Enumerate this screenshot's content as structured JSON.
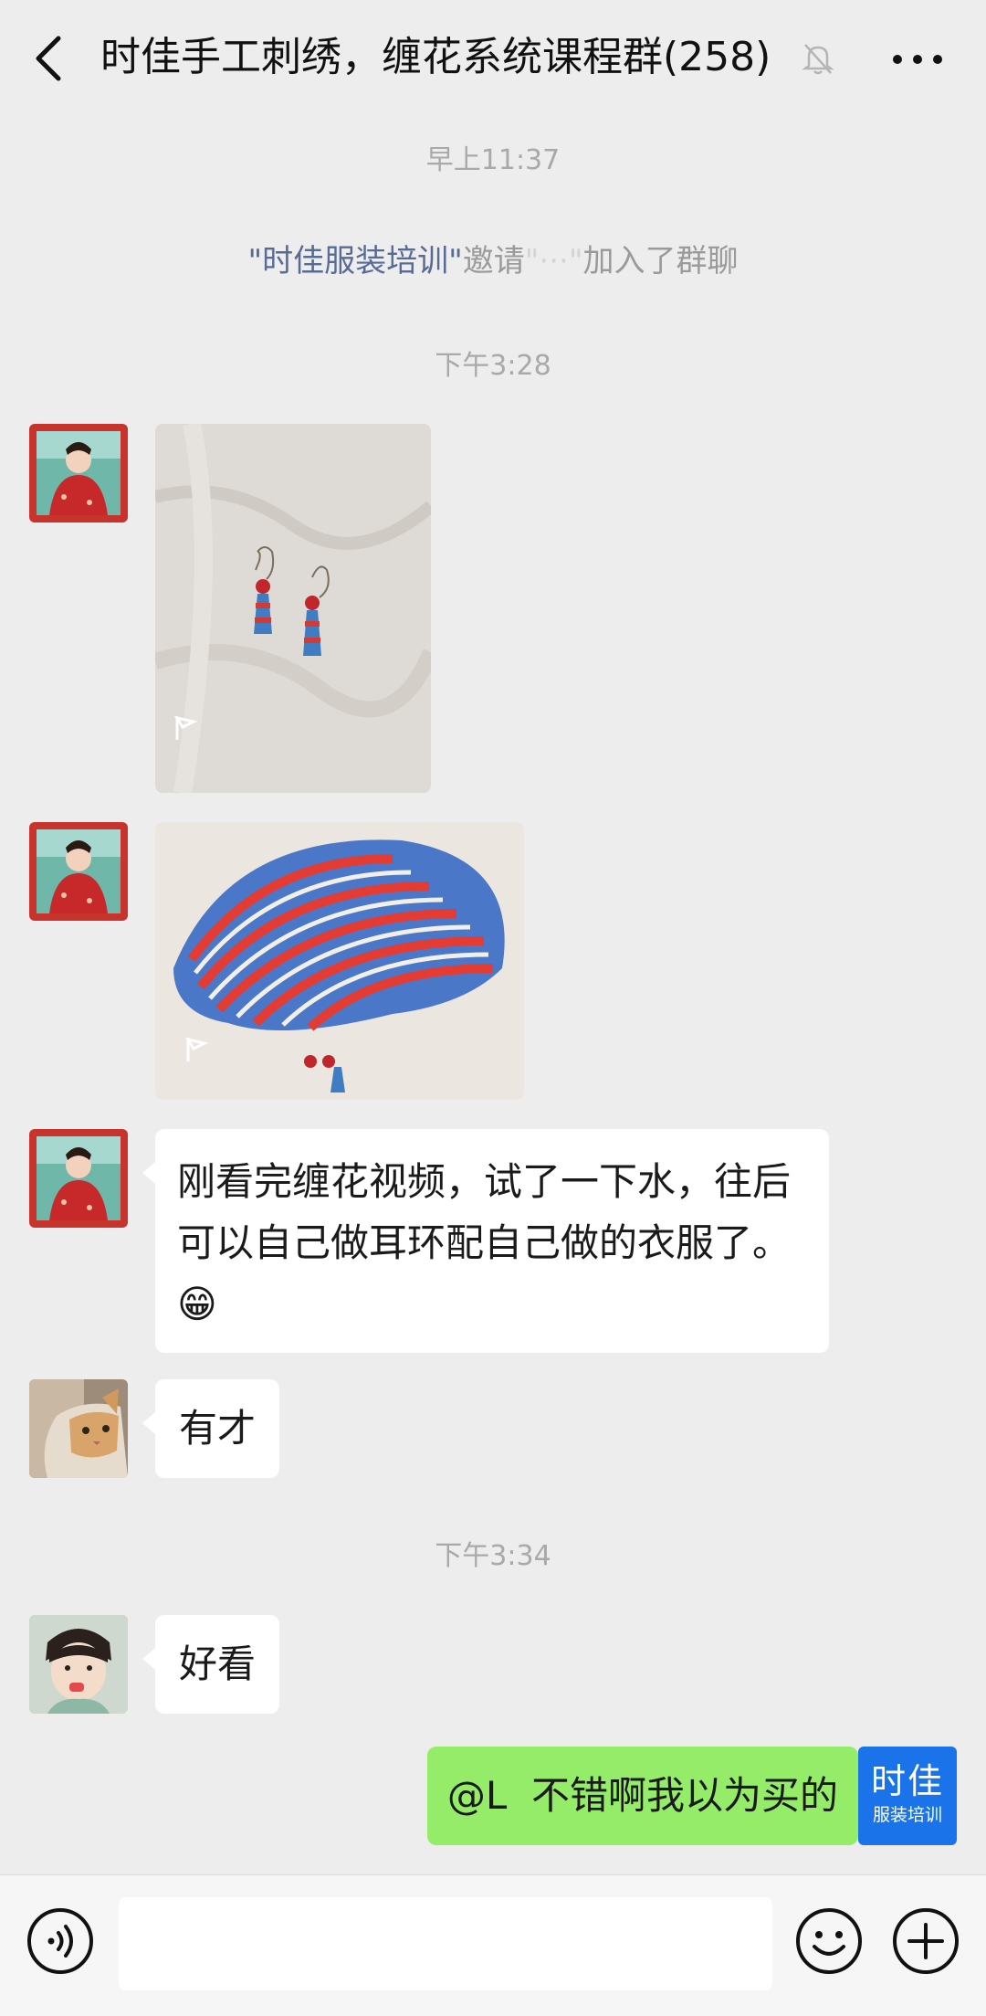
{
  "header": {
    "title": "时佳手工刺绣，缠花系统课程群(258)",
    "back_icon": "chevron-left-icon",
    "mute_icon": "bell-off-icon",
    "more_icon": "ellipsis-icon"
  },
  "timestamps": {
    "t1": "早上11:37",
    "t2": "下午3:28",
    "t3": "下午3:34"
  },
  "system_message": {
    "inviter": "\"时佳服装培训\"",
    "verb": "邀请",
    "invitee": "\"···\"",
    "suffix": "加入了群聊"
  },
  "messages": {
    "m3_text": "刚看完缠花视频，试了一下水，往后可以自己做耳环配自己做的衣服了。😁",
    "m4_text": "有才",
    "m5_text": "好看",
    "m6_mention": "@L",
    "m6_text": "不错啊我以为买的"
  },
  "self_avatar": {
    "line1": "时佳",
    "line2": "服装培训",
    "color": "#1a73e8"
  },
  "input_bar": {
    "voice_icon": "voice-icon",
    "emoji_icon": "smiley-icon",
    "plus_icon": "plus-circle-icon",
    "placeholder": ""
  },
  "colors": {
    "background": "#ededed",
    "outgoing_bubble": "#95ec69",
    "incoming_bubble": "#ffffff",
    "link": "#576b95"
  }
}
